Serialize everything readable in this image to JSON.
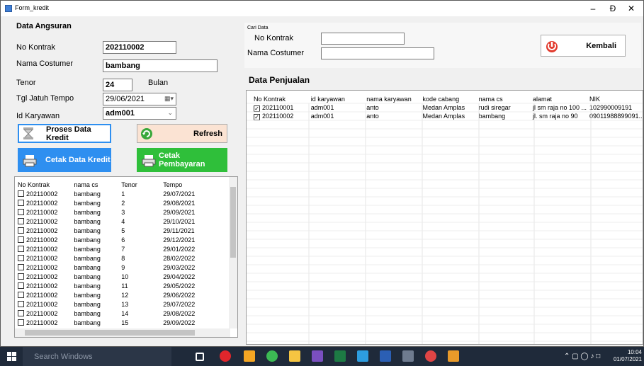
{
  "window": {
    "title": "Form_kredit",
    "minimize": "–",
    "maximize": "Ɖ",
    "close": "✕"
  },
  "angsuran": {
    "heading": "Data Angsuran",
    "no_kontrak_label": "No Kontrak",
    "no_kontrak_value": "202110002",
    "nama_label": "Nama Costumer",
    "nama_value": "bambang",
    "tenor_label": "Tenor",
    "tenor_value": "24",
    "tenor_unit": "Bulan",
    "tgl_label": "Tgl Jatuh Tempo",
    "tgl_value": "29/06/2021",
    "karyawan_label": "Id Karyawan",
    "karyawan_value": "adm001"
  },
  "buttons": {
    "proses": "Proses Data Kredit",
    "refresh": "Refresh",
    "cetak_kredit": "Cetak Data Kredit",
    "cetak_pembayaran": "Cetak Pembayaran",
    "kembali": "Kembali"
  },
  "angsuran_grid": {
    "headers": [
      "No Kontrak",
      "nama cs",
      "Tenor",
      "Tempo"
    ],
    "rows": [
      [
        "202110002",
        "bambang",
        "1",
        "29/07/2021"
      ],
      [
        "202110002",
        "bambang",
        "2",
        "29/08/2021"
      ],
      [
        "202110002",
        "bambang",
        "3",
        "29/09/2021"
      ],
      [
        "202110002",
        "bambang",
        "4",
        "29/10/2021"
      ],
      [
        "202110002",
        "bambang",
        "5",
        "29/11/2021"
      ],
      [
        "202110002",
        "bambang",
        "6",
        "29/12/2021"
      ],
      [
        "202110002",
        "bambang",
        "7",
        "29/01/2022"
      ],
      [
        "202110002",
        "bambang",
        "8",
        "28/02/2022"
      ],
      [
        "202110002",
        "bambang",
        "9",
        "29/03/2022"
      ],
      [
        "202110002",
        "bambang",
        "10",
        "29/04/2022"
      ],
      [
        "202110002",
        "bambang",
        "11",
        "29/05/2022"
      ],
      [
        "202110002",
        "bambang",
        "12",
        "29/06/2022"
      ],
      [
        "202110002",
        "bambang",
        "13",
        "29/07/2022"
      ],
      [
        "202110002",
        "bambang",
        "14",
        "29/08/2022"
      ],
      [
        "202110002",
        "bambang",
        "15",
        "29/09/2022"
      ]
    ]
  },
  "cari": {
    "group_label": "Cari Data",
    "no_kontrak_label": "No Kontrak",
    "no_kontrak_value": "",
    "nama_label": "Nama Costumer",
    "nama_value": ""
  },
  "penjualan": {
    "heading": "Data Penjualan",
    "headers": [
      "No Kontrak",
      "id karyawan",
      "nama karyawan",
      "kode cabang",
      "nama cs",
      "alamat",
      "NIK"
    ],
    "rows": [
      [
        "202110001",
        "adm001",
        "anto",
        "Medan Amplas",
        "rudi siregar",
        "jl sm raja no 100 ...",
        "102990009191"
      ],
      [
        "202110002",
        "adm001",
        "anto",
        "Medan Amplas",
        "bambang",
        "jl. sm raja no 90",
        "09011988899091..."
      ]
    ]
  },
  "taskbar": {
    "search_placeholder": "Search Windows",
    "time": "10:04",
    "date": "01/07/2021"
  },
  "colors": {
    "accent_blue": "#2e8ff0",
    "accent_green": "#2fbf3a",
    "refresh_bg": "#fbe3d3"
  }
}
